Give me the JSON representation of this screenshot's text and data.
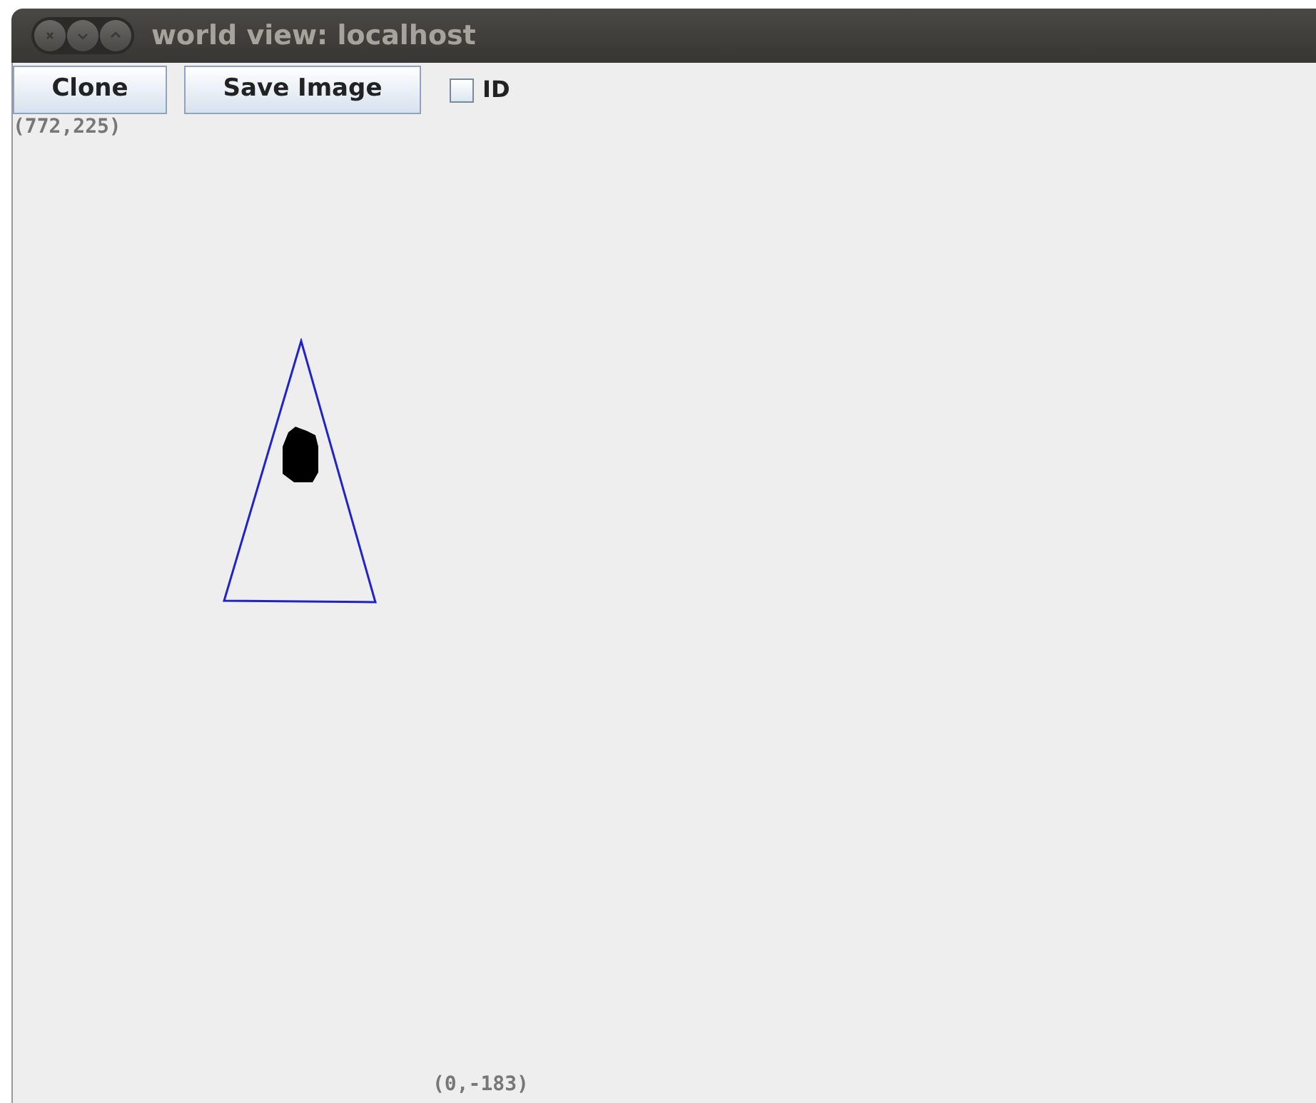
{
  "window": {
    "title": "world view: localhost"
  },
  "toolbar": {
    "buttons": [
      "Clone",
      "Save Image"
    ],
    "checkbox": {
      "label": "ID",
      "checked": false
    }
  },
  "canvas": {
    "top_coordinate": "(772,225)",
    "bottom_coordinate": "(0,-183)"
  }
}
